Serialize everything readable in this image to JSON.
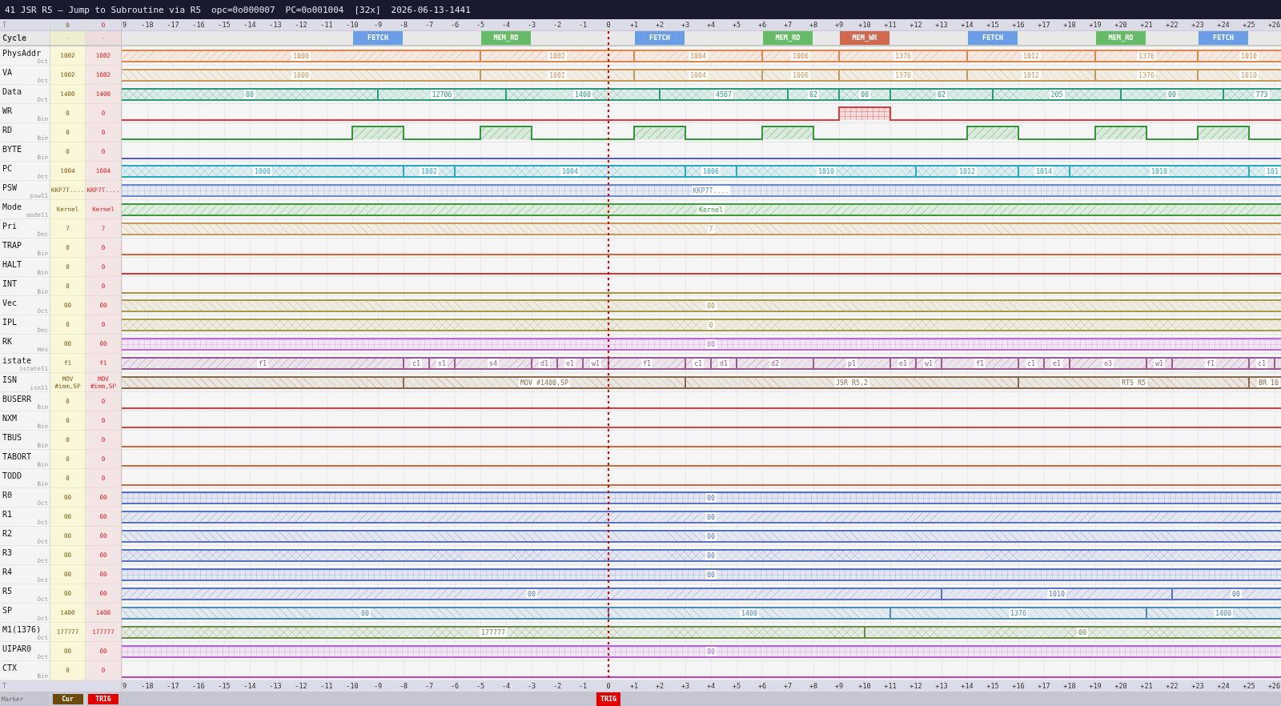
{
  "title": {
    "text": "41 JSR R5 — Jump to Subroutine via R5",
    "opcode": "opc=0o000007",
    "pc": "PC=0o001004",
    "zoom": "[32x]",
    "timestamp": "2026-06-13-1441"
  },
  "ruler": {
    "label": "T",
    "cur_value": "0",
    "trig_value": "0",
    "ticks": [
      "9",
      "-18",
      "-17",
      "-16",
      "-15",
      "-14",
      "-13",
      "-12",
      "-11",
      "-10",
      "-9",
      "-8",
      "-7",
      "-6",
      "-5",
      "-4",
      "-3",
      "-2",
      "-1",
      "0",
      "+1",
      "+2",
      "+3",
      "+4",
      "+5",
      "+6",
      "+7",
      "+8",
      "+9",
      "+10",
      "+11",
      "+12",
      "+13",
      "+14",
      "+15",
      "+16",
      "+17",
      "+18",
      "+19",
      "+20",
      "+21",
      "+22",
      "+23",
      "+24",
      "+25",
      "+26"
    ]
  },
  "cycle_row": {
    "label": "Cycle",
    "cur_value": "-",
    "trig_value": "-",
    "phases": [
      {
        "label": "FETCH",
        "color": "#6a9de6"
      },
      {
        "label": "MEM_RD",
        "color": "#66bb66"
      },
      {
        "label": "FETCH",
        "color": "#6a9de6"
      },
      {
        "label": "MEM_RD",
        "color": "#66bb66"
      },
      {
        "label": "MEM_WR",
        "color": "#d0694f"
      },
      {
        "label": "FETCH",
        "color": "#6a9de6"
      },
      {
        "label": "MEM_RD",
        "color": "#66bb66"
      },
      {
        "label": "FETCH",
        "color": "#6a9de6"
      }
    ]
  },
  "signals": [
    {
      "name": "PhysAddr",
      "radix": "Oct",
      "cur_value": "1002",
      "trig_value": "1002",
      "kind": "bus",
      "color": "#e0864a",
      "segments": [
        {
          "value": "1000"
        },
        {
          "value": "1002"
        },
        {
          "value": "1004"
        },
        {
          "value": "1006"
        },
        {
          "value": "1376"
        },
        {
          "value": "1012"
        },
        {
          "value": "1376"
        },
        {
          "value": "1010"
        }
      ]
    },
    {
      "name": "VA",
      "radix": "Oct",
      "cur_value": "1002",
      "trig_value": "1002",
      "kind": "bus",
      "color": "#c49a5c",
      "segments": [
        {
          "value": "1000"
        },
        {
          "value": "1002"
        },
        {
          "value": "1004"
        },
        {
          "value": "1006"
        },
        {
          "value": "1376"
        },
        {
          "value": "1012"
        },
        {
          "value": "1376"
        },
        {
          "value": "1010"
        }
      ]
    },
    {
      "name": "Data",
      "radix": "Oct",
      "cur_value": "1400",
      "trig_value": "1400",
      "kind": "bus",
      "color": "#2a9a7a",
      "segments": [
        {
          "value": "00"
        },
        {
          "value": "12706"
        },
        {
          "value": "1400"
        },
        {
          "value": "4567"
        },
        {
          "value": "02"
        },
        {
          "value": "00"
        },
        {
          "value": "02"
        },
        {
          "value": "205"
        },
        {
          "value": "00"
        },
        {
          "value": "773"
        }
      ]
    },
    {
      "name": "WR",
      "radix": "Bin",
      "cur_value": "0",
      "trig_value": "0",
      "kind": "bit",
      "color": "#e03a3a"
    },
    {
      "name": "RD",
      "radix": "Bin",
      "cur_value": "0",
      "trig_value": "0",
      "kind": "bit",
      "color": "#2e9a3a"
    },
    {
      "name": "BYTE",
      "radix": "Bin",
      "cur_value": "0",
      "trig_value": "0",
      "kind": "bit",
      "color": "#5a5ad0"
    },
    {
      "name": "PC",
      "radix": "Oct",
      "cur_value": "1004",
      "trig_value": "1004",
      "kind": "bus",
      "color": "#2aa8c0",
      "segments": [
        {
          "value": "1000"
        },
        {
          "value": "1002"
        },
        {
          "value": "1004"
        },
        {
          "value": "1006"
        },
        {
          "value": "1010"
        },
        {
          "value": "1012"
        },
        {
          "value": "1014"
        },
        {
          "value": "1010"
        },
        {
          "value": "101"
        }
      ]
    },
    {
      "name": "PSW",
      "radix": "psw11",
      "cur_value": "KKP7T....",
      "trig_value": "KKP7T....",
      "kind": "bus",
      "color": "#6a88d0",
      "segments": [
        {
          "value": "KKP7T...."
        }
      ]
    },
    {
      "name": "Mode",
      "radix": "mode11",
      "cur_value": "Kernel",
      "trig_value": "Kernel",
      "kind": "bus",
      "color": "#3c9a3c",
      "segments": [
        {
          "value": "Kernel"
        }
      ]
    },
    {
      "name": "Pri",
      "radix": "Dec",
      "cur_value": "7",
      "trig_value": "7",
      "kind": "bus",
      "color": "#c49a5c",
      "segments": [
        {
          "value": "7"
        }
      ]
    },
    {
      "name": "TRAP",
      "radix": "Bin",
      "cur_value": "0",
      "trig_value": "0",
      "kind": "bit",
      "color": "#d0683a"
    },
    {
      "name": "HALT",
      "radix": "Bin",
      "cur_value": "0",
      "trig_value": "0",
      "kind": "bit",
      "color": "#e03030"
    },
    {
      "name": "INT",
      "radix": "Bin",
      "cur_value": "0",
      "trig_value": "0",
      "kind": "bit",
      "color": "#a8943a"
    },
    {
      "name": "Vec",
      "radix": "Oct",
      "cur_value": "00",
      "trig_value": "00",
      "kind": "bus",
      "color": "#a8984c",
      "segments": [
        {
          "value": "00"
        }
      ]
    },
    {
      "name": "IPL",
      "radix": "Dec",
      "cur_value": "0",
      "trig_value": "0",
      "kind": "bus",
      "color": "#a8984c",
      "segments": [
        {
          "value": "0"
        }
      ]
    },
    {
      "name": "RK",
      "radix": "Hex",
      "cur_value": "00",
      "trig_value": "00",
      "kind": "bus",
      "color": "#c06ad8",
      "segments": [
        {
          "value": "00"
        }
      ]
    },
    {
      "name": "istate",
      "radix": "istate11",
      "cur_value": "f1",
      "trig_value": "f1",
      "kind": "bus",
      "color": "#9a5a96",
      "segments": [
        {
          "value": "f1"
        },
        {
          "value": "c1"
        },
        {
          "value": "s1"
        },
        {
          "value": "s4"
        },
        {
          "value": "d1"
        },
        {
          "value": "e1"
        },
        {
          "value": "w1"
        },
        {
          "value": "f1"
        },
        {
          "value": "c1"
        },
        {
          "value": "d1"
        },
        {
          "value": "d2"
        },
        {
          "value": "p1"
        },
        {
          "value": "e1"
        },
        {
          "value": "w1"
        },
        {
          "value": "f1"
        },
        {
          "value": "c1"
        },
        {
          "value": "e1"
        },
        {
          "value": "o3"
        },
        {
          "value": "w1"
        },
        {
          "value": "f1"
        },
        {
          "value": "c1"
        }
      ]
    },
    {
      "name": "ISN",
      "radix": "isn11",
      "cur_value": "MOV #imm,SP",
      "trig_value": "MOV #imm,SP",
      "kind": "bus",
      "color": "#8a6a4a",
      "segments": [
        {
          "value": "MOV #1400,SP"
        },
        {
          "value": "JSR R5,2"
        },
        {
          "value": "RTS R5"
        },
        {
          "value": "BR 10"
        }
      ]
    },
    {
      "name": "BUSERR",
      "radix": "Bin",
      "cur_value": "0",
      "trig_value": "0",
      "kind": "bit",
      "color": "#e03a3a"
    },
    {
      "name": "NXM",
      "radix": "Bin",
      "cur_value": "0",
      "trig_value": "0",
      "kind": "bit",
      "color": "#d84444"
    },
    {
      "name": "TBUS",
      "radix": "Bin",
      "cur_value": "0",
      "trig_value": "0",
      "kind": "bit",
      "color": "#d0683a"
    },
    {
      "name": "TABORT",
      "radix": "Bin",
      "cur_value": "0",
      "trig_value": "0",
      "kind": "bit",
      "color": "#d0683a"
    },
    {
      "name": "TODD",
      "radix": "Bin",
      "cur_value": "0",
      "trig_value": "0",
      "kind": "bit",
      "color": "#d0683a"
    },
    {
      "name": "R0",
      "radix": "Oct",
      "cur_value": "00",
      "trig_value": "00",
      "kind": "bus",
      "color": "#5a72c4",
      "segments": [
        {
          "value": "00"
        }
      ]
    },
    {
      "name": "R1",
      "radix": "Oct",
      "cur_value": "00",
      "trig_value": "00",
      "kind": "bus",
      "color": "#5a72c4",
      "segments": [
        {
          "value": "00"
        }
      ]
    },
    {
      "name": "R2",
      "radix": "Oct",
      "cur_value": "00",
      "trig_value": "00",
      "kind": "bus",
      "color": "#5a72c4",
      "segments": [
        {
          "value": "00"
        }
      ]
    },
    {
      "name": "R3",
      "radix": "Oct",
      "cur_value": "00",
      "trig_value": "00",
      "kind": "bus",
      "color": "#5a72c4",
      "segments": [
        {
          "value": "00"
        }
      ]
    },
    {
      "name": "R4",
      "radix": "Oct",
      "cur_value": "00",
      "trig_value": "00",
      "kind": "bus",
      "color": "#5a72c4",
      "segments": [
        {
          "value": "00"
        }
      ]
    },
    {
      "name": "R5",
      "radix": "Oct",
      "cur_value": "00",
      "trig_value": "00",
      "kind": "bus",
      "color": "#5a72c4",
      "segments": [
        {
          "value": "00"
        },
        {
          "value": "1010"
        },
        {
          "value": "00"
        }
      ]
    },
    {
      "name": "SP",
      "radix": "Oct",
      "cur_value": "1400",
      "trig_value": "1400",
      "kind": "bus",
      "color": "#4a8cb4",
      "segments": [
        {
          "value": "00"
        },
        {
          "value": "1400"
        },
        {
          "value": "1376"
        },
        {
          "value": "1400"
        }
      ]
    },
    {
      "name": "M1(1376)",
      "radix": "Oct",
      "cur_value": "177777",
      "trig_value": "177777",
      "kind": "bus",
      "color": "#6a8c4a",
      "segments": [
        {
          "value": "177777"
        },
        {
          "value": "00"
        }
      ]
    },
    {
      "name": "UIPAR0",
      "radix": "Oct",
      "cur_value": "00",
      "trig_value": "00",
      "kind": "bus",
      "color": "#b464d8",
      "segments": [
        {
          "value": "00"
        }
      ]
    },
    {
      "name": "CTX",
      "radix": "Bin",
      "cur_value": "0",
      "trig_value": "0",
      "kind": "bit",
      "color": "#c040c0"
    }
  ],
  "bottom_ruler": {
    "label": "T",
    "ticks": [
      "9",
      "-18",
      "-17",
      "-16",
      "-15",
      "-14",
      "-13",
      "-12",
      "-11",
      "-10",
      "-9",
      "-8",
      "-7",
      "-6",
      "-5",
      "-4",
      "-3",
      "-2",
      "-1",
      "0",
      "+1",
      "+2",
      "+3",
      "+4",
      "+5",
      "+6",
      "+7",
      "+8",
      "+9",
      "+10",
      "+11",
      "+12",
      "+13",
      "+14",
      "+15",
      "+16",
      "+17",
      "+18",
      "+19",
      "+20",
      "+21",
      "+22",
      "+23",
      "+24",
      "+25",
      "+26"
    ]
  },
  "marker_bar": {
    "label": "Marker",
    "buttons": [
      {
        "label": "Cur",
        "color": "#6b4a0e"
      },
      {
        "label": "TRIG",
        "color": "#e00000"
      }
    ],
    "markers": [
      {
        "label": "TRIG",
        "color": "#e00000"
      }
    ]
  }
}
